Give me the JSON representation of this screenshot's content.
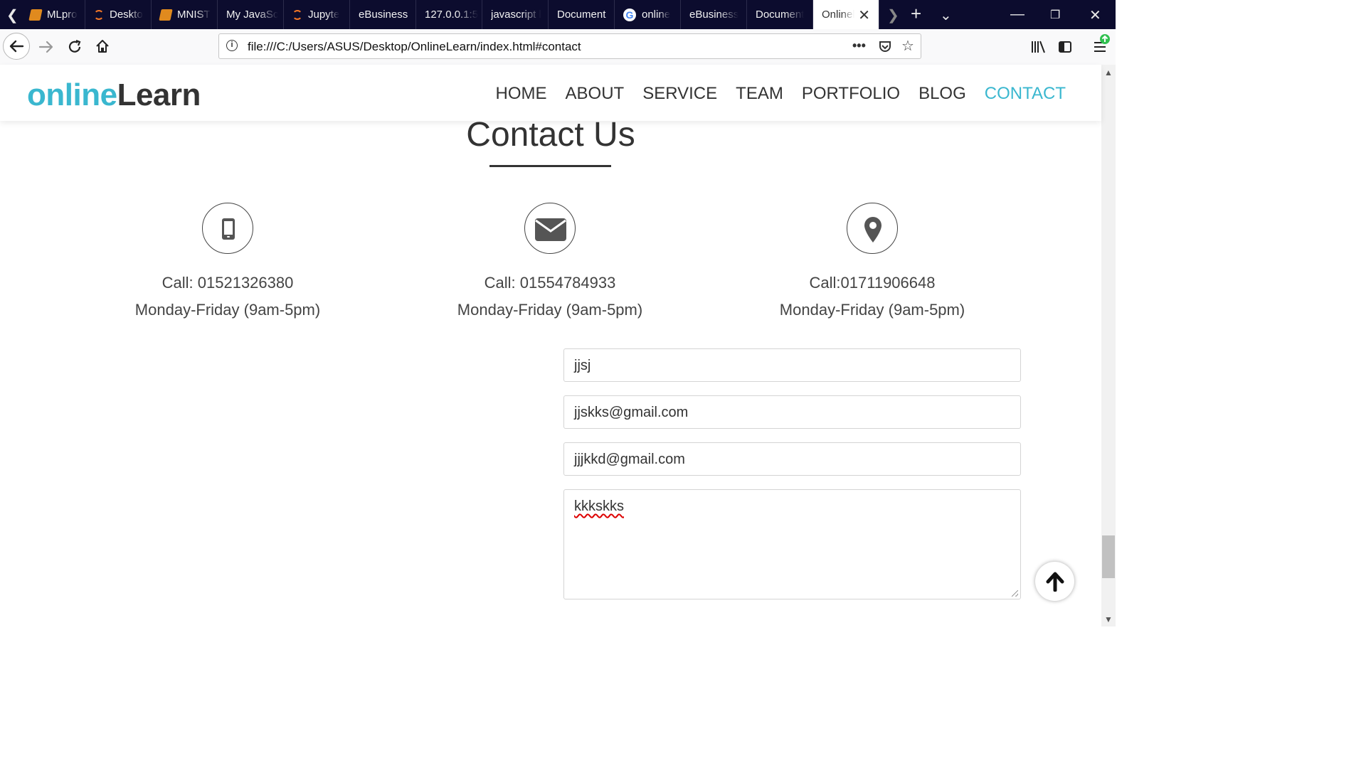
{
  "browser": {
    "tabs": [
      {
        "label": "MLpro",
        "icon": "book-icon"
      },
      {
        "label": "Deskto",
        "icon": "jupyter-icon"
      },
      {
        "label": "MNIST",
        "icon": "book-icon"
      },
      {
        "label": "My JavaSc",
        "icon": ""
      },
      {
        "label": "Jupyte",
        "icon": "jupyter-icon"
      },
      {
        "label": "eBusiness",
        "icon": ""
      },
      {
        "label": "127.0.0.1:5",
        "icon": ""
      },
      {
        "label": "javascript l",
        "icon": ""
      },
      {
        "label": "Document",
        "icon": ""
      },
      {
        "label": "online",
        "icon": "google-icon"
      },
      {
        "label": "eBusiness",
        "icon": ""
      },
      {
        "label": "Document",
        "icon": ""
      },
      {
        "label": "Onlinel",
        "icon": "",
        "active": true
      }
    ],
    "url": "file:///C:/Users/ASUS/Desktop/OnlineLearn/index.html#contact"
  },
  "site": {
    "logo_part1": "online",
    "logo_part2": "Learn",
    "accent_color": "#3ab7cf",
    "nav": [
      "HOME",
      "ABOUT",
      "SERVICE",
      "TEAM",
      "PORTFOLIO",
      "BLOG",
      "CONTACT"
    ],
    "active_nav": "CONTACT"
  },
  "contact": {
    "title": "Contact Us",
    "items": [
      {
        "icon": "mobile-phone-icon",
        "line1": "Call: 01521326380",
        "line2": "Monday-Friday (9am-5pm)"
      },
      {
        "icon": "envelope-icon",
        "line1": "Call: 01554784933",
        "line2": "Monday-Friday (9am-5pm)"
      },
      {
        "icon": "map-marker-icon",
        "line1": "Call:01711906648",
        "line2": "Monday-Friday (9am-5pm)"
      }
    ],
    "form": {
      "name": "jjsj",
      "email": "jjskks@gmail.com",
      "subject": "jjjkkd@gmail.com",
      "message": "kkkskks"
    }
  }
}
